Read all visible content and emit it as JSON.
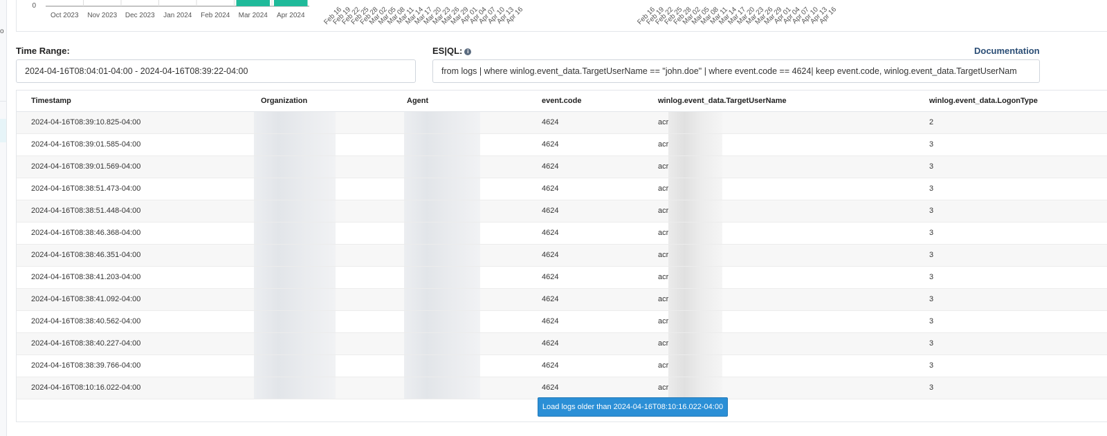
{
  "sidebar": {
    "tick_text": "o"
  },
  "chart": {
    "zero_label": "0",
    "monthly": {
      "categories": [
        "Oct 2023",
        "Nov 2023",
        "Dec 2023",
        "Jan 2024",
        "Feb 2024",
        "Mar 2024",
        "Apr 2024"
      ],
      "bar_color": "#1fba9a"
    },
    "daily_ticks": [
      "Feb 16",
      "Feb 19",
      "Feb 22",
      "Feb 25",
      "Feb 28",
      "Mar 02",
      "Mar 05",
      "Mar 08",
      "Mar 11",
      "Mar 14",
      "Mar 17",
      "Mar 20",
      "Mar 23",
      "Mar 26",
      "Mar 29",
      "Apr 01",
      "Apr 04",
      "Apr 07",
      "Apr 10",
      "Apr 13",
      "Apr 16"
    ]
  },
  "time_range": {
    "label": "Time Range:",
    "value": "2024-04-16T08:04:01-04:00 - 2024-04-16T08:39:22-04:00"
  },
  "esql": {
    "label": "ES|QL:",
    "value": "from logs | where winlog.event_data.TargetUserName == \"john.doe\" | where event.code == 4624| keep event.code, winlog.event_data.TargetUserNam"
  },
  "documentation_link": "Documentation",
  "table": {
    "columns": [
      "Timestamp",
      "Organization",
      "Agent",
      "event.code",
      "winlog.event_data.TargetUserName",
      "winlog.event_data.LogonType"
    ],
    "rows": [
      {
        "timestamp": "2024-04-16T08:39:10.825-04:00",
        "code": "4624",
        "user": "acr",
        "logon": "2"
      },
      {
        "timestamp": "2024-04-16T08:39:01.585-04:00",
        "code": "4624",
        "user": "acr",
        "logon": "3"
      },
      {
        "timestamp": "2024-04-16T08:39:01.569-04:00",
        "code": "4624",
        "user": "acr",
        "logon": "3"
      },
      {
        "timestamp": "2024-04-16T08:38:51.473-04:00",
        "code": "4624",
        "user": "acr",
        "logon": "3"
      },
      {
        "timestamp": "2024-04-16T08:38:51.448-04:00",
        "code": "4624",
        "user": "acr",
        "logon": "3"
      },
      {
        "timestamp": "2024-04-16T08:38:46.368-04:00",
        "code": "4624",
        "user": "acr",
        "logon": "3"
      },
      {
        "timestamp": "2024-04-16T08:38:46.351-04:00",
        "code": "4624",
        "user": "acr",
        "logon": "3"
      },
      {
        "timestamp": "2024-04-16T08:38:41.203-04:00",
        "code": "4624",
        "user": "acr",
        "logon": "3"
      },
      {
        "timestamp": "2024-04-16T08:38:41.092-04:00",
        "code": "4624",
        "user": "acr",
        "logon": "3"
      },
      {
        "timestamp": "2024-04-16T08:38:40.562-04:00",
        "code": "4624",
        "user": "acr",
        "logon": "3"
      },
      {
        "timestamp": "2024-04-16T08:38:40.227-04:00",
        "code": "4624",
        "user": "acr",
        "logon": "3"
      },
      {
        "timestamp": "2024-04-16T08:38:39.766-04:00",
        "code": "4624",
        "user": "acr",
        "logon": "3"
      },
      {
        "timestamp": "2024-04-16T08:10:16.022-04:00",
        "code": "4624",
        "user": "acr",
        "logon": "3"
      }
    ]
  },
  "load_button": "Load logs older than 2024-04-16T08:10:16.022-04:00",
  "colors": {
    "accent": "#2b8fd6",
    "link": "#2a4d75",
    "bar": "#1fba9a"
  }
}
